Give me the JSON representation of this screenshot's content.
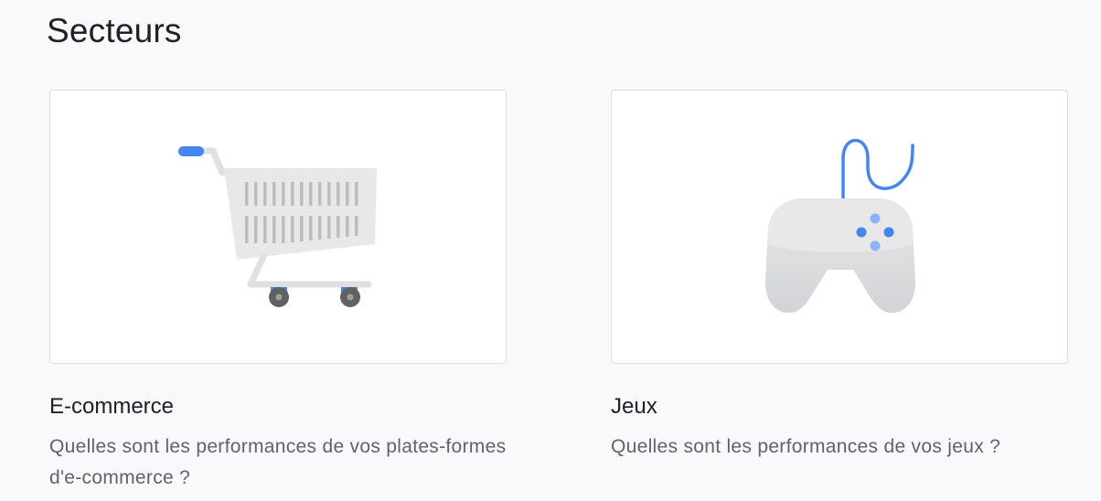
{
  "section": {
    "title": "Secteurs"
  },
  "cards": [
    {
      "title": "E-commerce",
      "description": "Quelles sont les performances de vos plates-formes d'e-commerce ?",
      "icon": "shopping-cart-icon"
    },
    {
      "title": "Jeux",
      "description": "Quelles sont les performances de vos jeux ?",
      "icon": "game-controller-icon"
    }
  ],
  "colors": {
    "background": "#f8f9fa",
    "card_border": "#dadce0",
    "accent_blue": "#4285f4",
    "light_blue": "#8ab4f8",
    "illustration_gray": "#e8eaed",
    "title_text": "#202124",
    "body_text": "#5f6368"
  }
}
